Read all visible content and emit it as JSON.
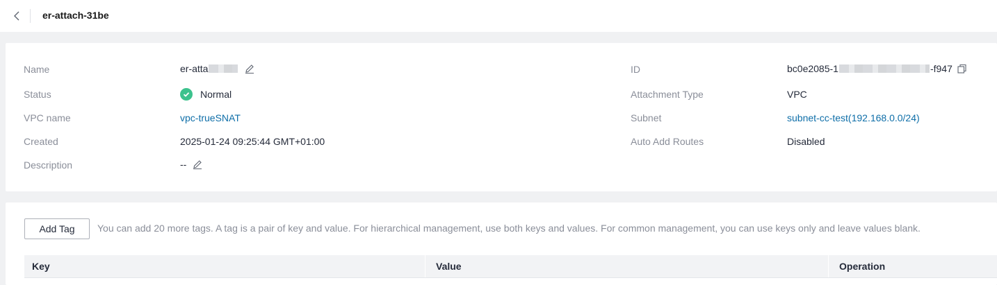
{
  "header": {
    "title": "er-attach-31be",
    "back_icon": "chevron-left-icon"
  },
  "basic_info": {
    "left": [
      {
        "label": "Name",
        "value_prefix": "er-atta"
      },
      {
        "label": "Status",
        "value": "Normal"
      },
      {
        "label": "VPC name",
        "value": "vpc-trueSNAT"
      },
      {
        "label": "Created",
        "value": "2025-01-24 09:25:44 GMT+01:00"
      },
      {
        "label": "Description",
        "value": "--"
      }
    ],
    "right": [
      {
        "label": "ID",
        "value_prefix": "bc0e2085-1",
        "value_suffix": "-f947"
      },
      {
        "label": "Attachment Type",
        "value": "VPC"
      },
      {
        "label": "Subnet",
        "value": "subnet-cc-test(192.168.0.0/24)"
      },
      {
        "label": "Auto Add Routes",
        "value": "Disabled"
      }
    ]
  },
  "tags": {
    "add_button": "Add Tag",
    "hint": "You can add 20 more tags. A tag is a pair of key and value. For hierarchical management, use both keys and values. For common management, you can use keys only and leave values blank.",
    "columns": [
      "Key",
      "Value",
      "Operation"
    ]
  },
  "colors": {
    "link": "#0e6ea8",
    "status_normal": "#3cc28d",
    "label": "#8a8e99",
    "text": "#252b3a"
  }
}
